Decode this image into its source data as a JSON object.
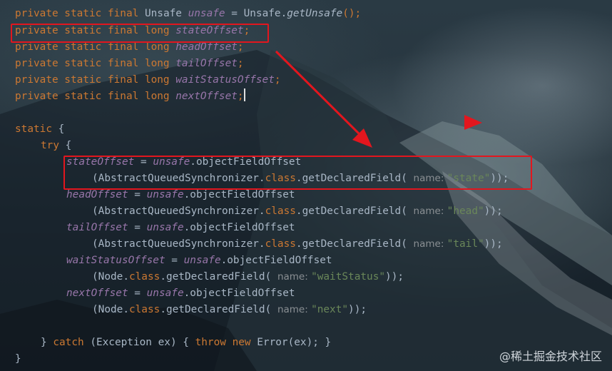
{
  "code": {
    "line1": {
      "kw": "private static final ",
      "type": "Unsafe ",
      "field": "unsafe",
      "eq": " = Unsafe.",
      "method": "getUnsafe",
      "end": "();"
    },
    "line2": {
      "kw": "private static final long ",
      "field": "stateOffset",
      "end": ";"
    },
    "line3": {
      "kw": "private static final long ",
      "field": "headOffset",
      "end": ";"
    },
    "line4": {
      "kw": "private static final long ",
      "field": "tailOffset",
      "end": ";"
    },
    "line5": {
      "kw": "private static final long ",
      "field": "waitStatusOffset",
      "end": ";"
    },
    "line6": {
      "kw": "private static final long ",
      "field": "nextOffset",
      "end": ";"
    },
    "static_kw": "static",
    "static_brace": " {",
    "try_kw": "try",
    "try_brace": " {",
    "assign_eq": " = ",
    "unsafe_ref": "unsafe",
    "ofo": ".objectFieldOffset",
    "aqs_open": "(AbstractQueuedSynchronizer.",
    "node_open": "(Node.",
    "class_kw": "class",
    "gdf": ".getDeclaredField( ",
    "hint": "name: ",
    "close": "));",
    "state": {
      "field": "stateOffset",
      "arg": "\"state\""
    },
    "head": {
      "field": "headOffset",
      "arg": "\"head\""
    },
    "tail": {
      "field": "tailOffset",
      "arg": "\"tail\""
    },
    "waitStatus": {
      "field": "waitStatusOffset",
      "arg": "\"waitStatus\""
    },
    "next": {
      "field": "nextOffset",
      "arg": "\"next\""
    },
    "catch_close": "} ",
    "catch_kw": "catch",
    "catch_mid": " (Exception ex) { ",
    "throw_kw": "throw",
    "new_kw": " new",
    "catch_end": " Error(ex); }",
    "final_brace": "}"
  },
  "watermark": "@稀土掘金技术社区",
  "colors": {
    "highlight_box": "#e3161e",
    "arrow": "#e3161e",
    "keyword": "#cc7832",
    "field": "#9876aa",
    "string": "#6a8759"
  }
}
